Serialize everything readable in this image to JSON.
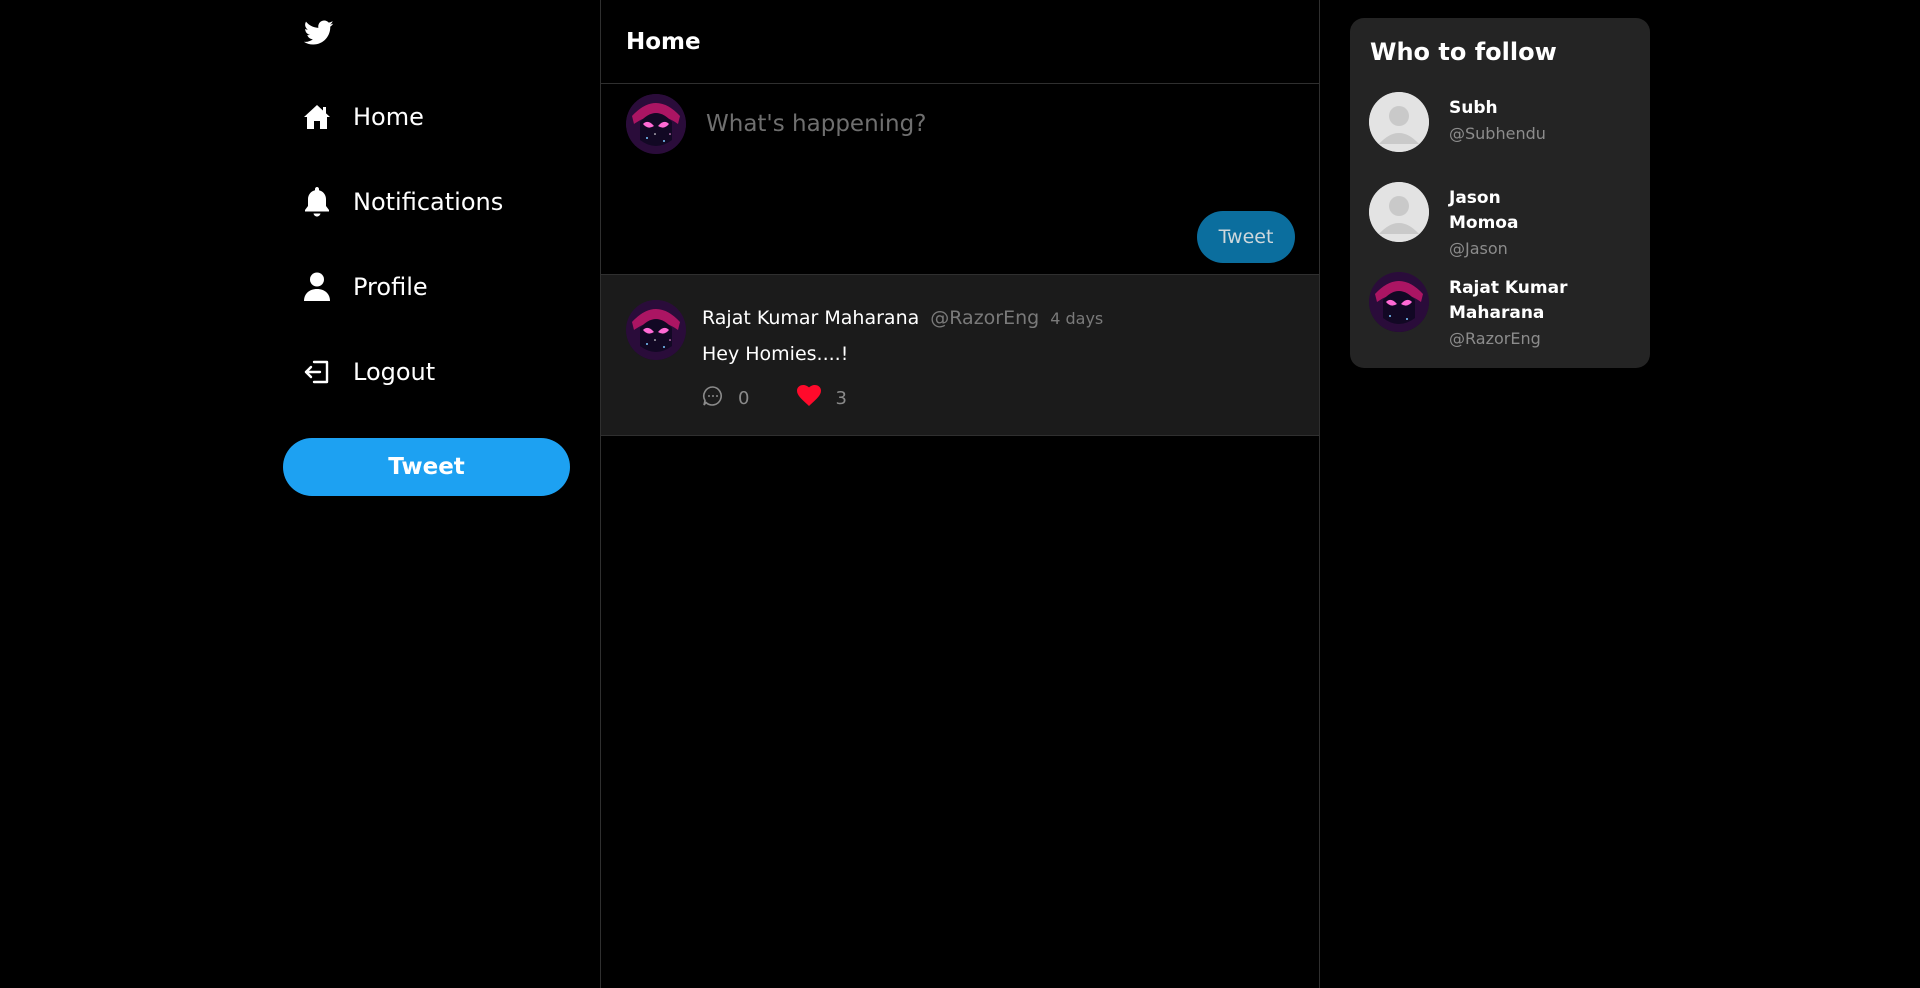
{
  "sidebar": {
    "logo_icon": "twitter-bird-icon",
    "items": [
      {
        "label": "Home",
        "icon": "home-icon"
      },
      {
        "label": "Notifications",
        "icon": "bell-icon"
      },
      {
        "label": "Profile",
        "icon": "user-icon"
      },
      {
        "label": "Logout",
        "icon": "logout-icon"
      }
    ],
    "tweet_button": "Tweet"
  },
  "main": {
    "title": "Home",
    "composer": {
      "placeholder": "What's happening?",
      "tweet_button": "Tweet"
    },
    "tweets": [
      {
        "name": "Rajat Kumar Maharana",
        "handle": "@RazorEng",
        "time": "4 days",
        "text": "Hey Homies....!",
        "comments": "0",
        "likes": "3"
      }
    ]
  },
  "who_to_follow": {
    "title": "Who to follow",
    "users": [
      {
        "name": "Subh",
        "handle": "@Subhendu"
      },
      {
        "name": "Jason Momoa",
        "handle": "@Jason"
      },
      {
        "name": "Rajat Kumar Maharana",
        "handle": "@RazorEng"
      }
    ]
  },
  "colors": {
    "accent": "#1da1f2",
    "composer_button": "#0b6e9e",
    "like": "#e0245e",
    "card_bg": "#242424",
    "tweet_bg": "#1b1b1b"
  }
}
